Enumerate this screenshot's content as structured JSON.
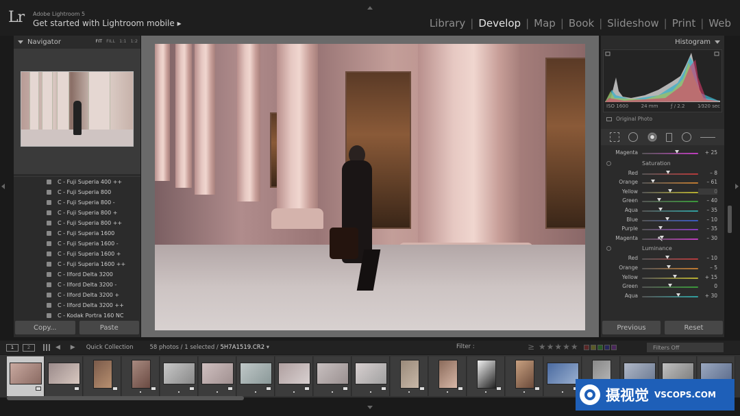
{
  "app": {
    "logo": "Lr",
    "name": "Adobe Lightroom 5",
    "subtitle": "Get started with Lightroom mobile",
    "subtitle_arrow": "▸"
  },
  "modules": [
    {
      "label": "Library",
      "active": false
    },
    {
      "label": "Develop",
      "active": true
    },
    {
      "label": "Map",
      "active": false
    },
    {
      "label": "Book",
      "active": false
    },
    {
      "label": "Slideshow",
      "active": false
    },
    {
      "label": "Print",
      "active": false
    },
    {
      "label": "Web",
      "active": false
    }
  ],
  "module_sep": "|",
  "navigator": {
    "title": "Navigator",
    "zoom": [
      "FIT",
      "FILL",
      "1:1",
      "1:2"
    ],
    "zoom_selected": "FIT"
  },
  "presets": [
    "C - Fuji Superia 400 ++",
    "C - Fuji Superia 800",
    "C - Fuji Superia 800 -",
    "C - Fuji Superia 800 +",
    "C - Fuji Superia 800 ++",
    "C - Fuji Superia 1600",
    "C - Fuji Superia 1600 -",
    "C - Fuji Superia 1600 +",
    "C - Fuji Superia 1600 ++",
    "C - Ilford Delta 3200",
    "C - Ilford Delta 3200 -",
    "C - Ilford Delta 3200 +",
    "C - Ilford Delta 3200 ++",
    "C - Kodak Portra 160 NC"
  ],
  "left_buttons": {
    "copy": "Copy...",
    "paste": "Paste"
  },
  "histogram": {
    "title": "Histogram",
    "iso": "ISO 1600",
    "focal": "24 mm",
    "aperture": "ƒ / 2.2",
    "shutter": "1⁄320 sec",
    "original_photo": "Original Photo"
  },
  "hsl": {
    "top_row": {
      "name": "Magenta",
      "value": "+ 25",
      "pos": 0.62,
      "color": "#c03cc0"
    },
    "saturation": {
      "title": "Saturation",
      "rows": [
        {
          "name": "Red",
          "value": "– 8",
          "pos": 0.46
        },
        {
          "name": "Orange",
          "value": "– 61",
          "pos": 0.2
        },
        {
          "name": "Yellow",
          "value": "0",
          "pos": 0.5,
          "selected": true
        },
        {
          "name": "Green",
          "value": "– 40",
          "pos": 0.3
        },
        {
          "name": "Aqua",
          "value": "– 35",
          "pos": 0.33
        },
        {
          "name": "Blue",
          "value": "– 10",
          "pos": 0.45
        },
        {
          "name": "Purple",
          "value": "– 35",
          "pos": 0.33
        },
        {
          "name": "Magenta",
          "value": "– 30",
          "pos": 0.35
        }
      ]
    },
    "luminance": {
      "title": "Luminance",
      "rows": [
        {
          "name": "Red",
          "value": "– 10",
          "pos": 0.45
        },
        {
          "name": "Orange",
          "value": "– 5",
          "pos": 0.48
        },
        {
          "name": "Yellow",
          "value": "+ 15",
          "pos": 0.58
        },
        {
          "name": "Green",
          "value": "0",
          "pos": 0.5
        },
        {
          "name": "Aqua",
          "value": "+ 30",
          "pos": 0.65
        }
      ]
    },
    "track_colors": {
      "Red": "#b83a3a",
      "Orange": "#c07a30",
      "Yellow": "#b8b030",
      "Green": "#3a9a3a",
      "Aqua": "#30a0a0",
      "Blue": "#3a5ac0",
      "Purple": "#8a3ac0",
      "Magenta": "#c03cc0"
    }
  },
  "right_buttons": {
    "previous": "Previous",
    "reset": "Reset"
  },
  "filmbar": {
    "screen1": "1",
    "screen2": "2",
    "nav_arrows": "◀ ▶",
    "collection": "Quick Collection",
    "count": "58 photos / 1 selected / ",
    "filename": "5H7A1519.CR2",
    "filename_caret": " ▾",
    "filter_label": "Filter :",
    "stars": "≥ ★★★★★",
    "filters_off": "Filters Off"
  },
  "watermark": {
    "cn": "摄视觉",
    "en": "VSCOPS.COM"
  }
}
